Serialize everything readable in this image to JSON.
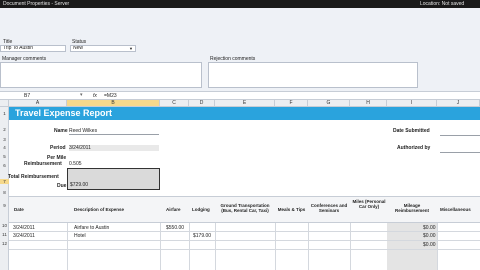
{
  "topbar": {
    "title": "Document Properties - Server",
    "right": "Location: Not saved"
  },
  "doc_properties": {
    "title_label": "Title",
    "title_value": "Trip To Austin",
    "status_label": "Status",
    "status_value": "New",
    "manager_comments_label": "Manager comments",
    "rejection_comments_label": "Rejection comments"
  },
  "formula_bar": {
    "cell_ref": "B7",
    "fx": "fx",
    "formula": "=M23"
  },
  "columns": [
    "A",
    "B",
    "C",
    "D",
    "E",
    "F",
    "G",
    "H",
    "I",
    "J"
  ],
  "rows": [
    "1",
    "2",
    "3",
    "4",
    "5",
    "6",
    "7",
    "8",
    "9",
    "10",
    "11",
    "12"
  ],
  "report": {
    "title": "Travel Expense Report",
    "name_label": "Name",
    "name_value": "Reed Wilkes",
    "period_label": "Period",
    "period_value": "3/24/2011",
    "per_mile_label": "Per Mile",
    "reimbursement_label": "Reimbursement",
    "reimbursement_value": "0.505",
    "total_label": "Total Reimbursement",
    "due_label": "Due",
    "due_value": "$729.00",
    "date_submitted_label": "Date Submitted",
    "authorized_label": "Authorized by"
  },
  "table": {
    "headers": [
      "Date",
      "Description of Expense",
      "Airfare",
      "Lodging",
      "Ground Transportation (Bus, Rental Car, Taxi)",
      "Meals & Tips",
      "Conferences and Seminars",
      "Miles (Personal Car Only)",
      "Mileage Reimbursement",
      "Miscellaneous"
    ],
    "rows": [
      {
        "date": "3/24/2011",
        "desc": "Airfare to Austin",
        "airfare": "$550.00",
        "lodging": "",
        "mileage": "$0.00"
      },
      {
        "date": "3/24/2011",
        "desc": "Hotel",
        "airfare": "",
        "lodging": "$179.00",
        "mileage": "$0.00"
      },
      {
        "date": "",
        "desc": "",
        "airfare": "",
        "lodging": "",
        "mileage": "$0.00"
      }
    ]
  }
}
